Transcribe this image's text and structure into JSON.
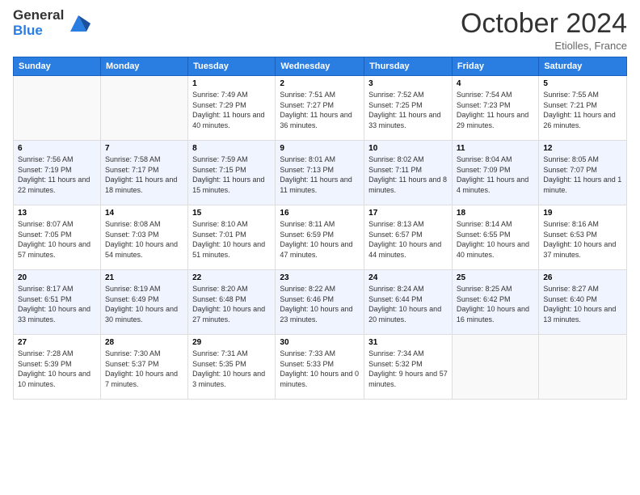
{
  "header": {
    "logo_line1": "General",
    "logo_line2": "Blue",
    "month": "October 2024",
    "location": "Etiolles, France"
  },
  "weekdays": [
    "Sunday",
    "Monday",
    "Tuesday",
    "Wednesday",
    "Thursday",
    "Friday",
    "Saturday"
  ],
  "weeks": [
    [
      null,
      null,
      {
        "day": 1,
        "sunrise": "7:49 AM",
        "sunset": "7:29 PM",
        "daylight": "11 hours and 40 minutes."
      },
      {
        "day": 2,
        "sunrise": "7:51 AM",
        "sunset": "7:27 PM",
        "daylight": "11 hours and 36 minutes."
      },
      {
        "day": 3,
        "sunrise": "7:52 AM",
        "sunset": "7:25 PM",
        "daylight": "11 hours and 33 minutes."
      },
      {
        "day": 4,
        "sunrise": "7:54 AM",
        "sunset": "7:23 PM",
        "daylight": "11 hours and 29 minutes."
      },
      {
        "day": 5,
        "sunrise": "7:55 AM",
        "sunset": "7:21 PM",
        "daylight": "11 hours and 26 minutes."
      }
    ],
    [
      {
        "day": 6,
        "sunrise": "7:56 AM",
        "sunset": "7:19 PM",
        "daylight": "11 hours and 22 minutes."
      },
      {
        "day": 7,
        "sunrise": "7:58 AM",
        "sunset": "7:17 PM",
        "daylight": "11 hours and 18 minutes."
      },
      {
        "day": 8,
        "sunrise": "7:59 AM",
        "sunset": "7:15 PM",
        "daylight": "11 hours and 15 minutes."
      },
      {
        "day": 9,
        "sunrise": "8:01 AM",
        "sunset": "7:13 PM",
        "daylight": "11 hours and 11 minutes."
      },
      {
        "day": 10,
        "sunrise": "8:02 AM",
        "sunset": "7:11 PM",
        "daylight": "11 hours and 8 minutes."
      },
      {
        "day": 11,
        "sunrise": "8:04 AM",
        "sunset": "7:09 PM",
        "daylight": "11 hours and 4 minutes."
      },
      {
        "day": 12,
        "sunrise": "8:05 AM",
        "sunset": "7:07 PM",
        "daylight": "11 hours and 1 minute."
      }
    ],
    [
      {
        "day": 13,
        "sunrise": "8:07 AM",
        "sunset": "7:05 PM",
        "daylight": "10 hours and 57 minutes."
      },
      {
        "day": 14,
        "sunrise": "8:08 AM",
        "sunset": "7:03 PM",
        "daylight": "10 hours and 54 minutes."
      },
      {
        "day": 15,
        "sunrise": "8:10 AM",
        "sunset": "7:01 PM",
        "daylight": "10 hours and 51 minutes."
      },
      {
        "day": 16,
        "sunrise": "8:11 AM",
        "sunset": "6:59 PM",
        "daylight": "10 hours and 47 minutes."
      },
      {
        "day": 17,
        "sunrise": "8:13 AM",
        "sunset": "6:57 PM",
        "daylight": "10 hours and 44 minutes."
      },
      {
        "day": 18,
        "sunrise": "8:14 AM",
        "sunset": "6:55 PM",
        "daylight": "10 hours and 40 minutes."
      },
      {
        "day": 19,
        "sunrise": "8:16 AM",
        "sunset": "6:53 PM",
        "daylight": "10 hours and 37 minutes."
      }
    ],
    [
      {
        "day": 20,
        "sunrise": "8:17 AM",
        "sunset": "6:51 PM",
        "daylight": "10 hours and 33 minutes."
      },
      {
        "day": 21,
        "sunrise": "8:19 AM",
        "sunset": "6:49 PM",
        "daylight": "10 hours and 30 minutes."
      },
      {
        "day": 22,
        "sunrise": "8:20 AM",
        "sunset": "6:48 PM",
        "daylight": "10 hours and 27 minutes."
      },
      {
        "day": 23,
        "sunrise": "8:22 AM",
        "sunset": "6:46 PM",
        "daylight": "10 hours and 23 minutes."
      },
      {
        "day": 24,
        "sunrise": "8:24 AM",
        "sunset": "6:44 PM",
        "daylight": "10 hours and 20 minutes."
      },
      {
        "day": 25,
        "sunrise": "8:25 AM",
        "sunset": "6:42 PM",
        "daylight": "10 hours and 16 minutes."
      },
      {
        "day": 26,
        "sunrise": "8:27 AM",
        "sunset": "6:40 PM",
        "daylight": "10 hours and 13 minutes."
      }
    ],
    [
      {
        "day": 27,
        "sunrise": "7:28 AM",
        "sunset": "5:39 PM",
        "daylight": "10 hours and 10 minutes."
      },
      {
        "day": 28,
        "sunrise": "7:30 AM",
        "sunset": "5:37 PM",
        "daylight": "10 hours and 7 minutes."
      },
      {
        "day": 29,
        "sunrise": "7:31 AM",
        "sunset": "5:35 PM",
        "daylight": "10 hours and 3 minutes."
      },
      {
        "day": 30,
        "sunrise": "7:33 AM",
        "sunset": "5:33 PM",
        "daylight": "10 hours and 0 minutes."
      },
      {
        "day": 31,
        "sunrise": "7:34 AM",
        "sunset": "5:32 PM",
        "daylight": "9 hours and 57 minutes."
      },
      null,
      null
    ]
  ]
}
